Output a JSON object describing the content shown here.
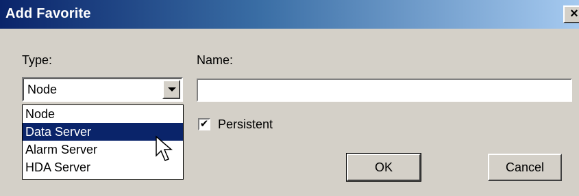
{
  "window": {
    "title": "Add Favorite",
    "close_glyph": "×"
  },
  "type_field": {
    "label": "Type:",
    "selected_value": "Node",
    "options": [
      "Node",
      "Data Server",
      "Alarm Server",
      "HDA Server"
    ],
    "highlighted_option": "Data Server"
  },
  "name_field": {
    "label": "Name:",
    "value": ""
  },
  "persistent": {
    "label": "Persistent",
    "checked": true,
    "check_glyph": "✔"
  },
  "buttons": {
    "ok": "OK",
    "cancel": "Cancel"
  },
  "colors": {
    "title_start": "#0a246a",
    "title_end": "#a6caf0",
    "highlight": "#0a246a",
    "face": "#d4d0c8"
  },
  "icons": {
    "cursor": "arrow-cursor-icon",
    "dropdown": "chevron-down-icon",
    "close": "close-icon"
  }
}
